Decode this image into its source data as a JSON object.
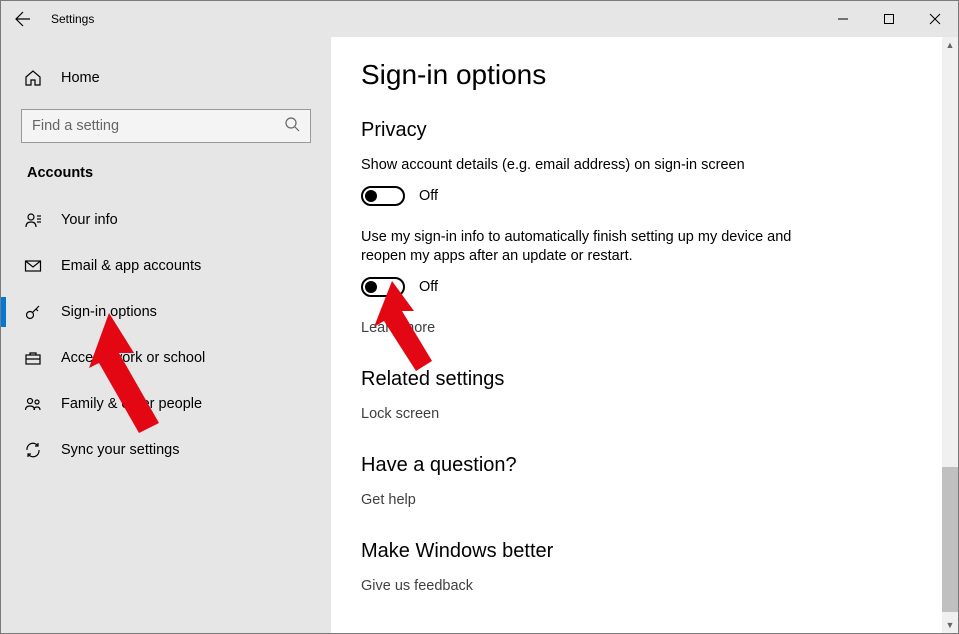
{
  "titlebar": {
    "title": "Settings"
  },
  "sidebar": {
    "home_label": "Home",
    "search_placeholder": "Find a setting",
    "section_label": "Accounts",
    "items": [
      {
        "icon": "person-icon",
        "label": "Your info"
      },
      {
        "icon": "mail-icon",
        "label": "Email & app accounts"
      },
      {
        "icon": "key-icon",
        "label": "Sign-in options"
      },
      {
        "icon": "briefcase-icon",
        "label": "Access work or school"
      },
      {
        "icon": "people-icon",
        "label": "Family & other people"
      },
      {
        "icon": "sync-icon",
        "label": "Sync your settings"
      }
    ]
  },
  "main": {
    "page_title": "Sign-in options",
    "privacy": {
      "heading": "Privacy",
      "toggle1_desc": "Show account details (e.g. email address) on sign-in screen",
      "toggle1_state": "Off",
      "toggle2_desc": "Use my sign-in info to automatically finish setting up my device and reopen my apps after an update or restart.",
      "toggle2_state": "Off",
      "learn_more": "Learn more"
    },
    "related": {
      "heading": "Related settings",
      "link": "Lock screen"
    },
    "question": {
      "heading": "Have a question?",
      "link": "Get help"
    },
    "feedback": {
      "heading": "Make Windows better",
      "link": "Give us feedback"
    }
  }
}
